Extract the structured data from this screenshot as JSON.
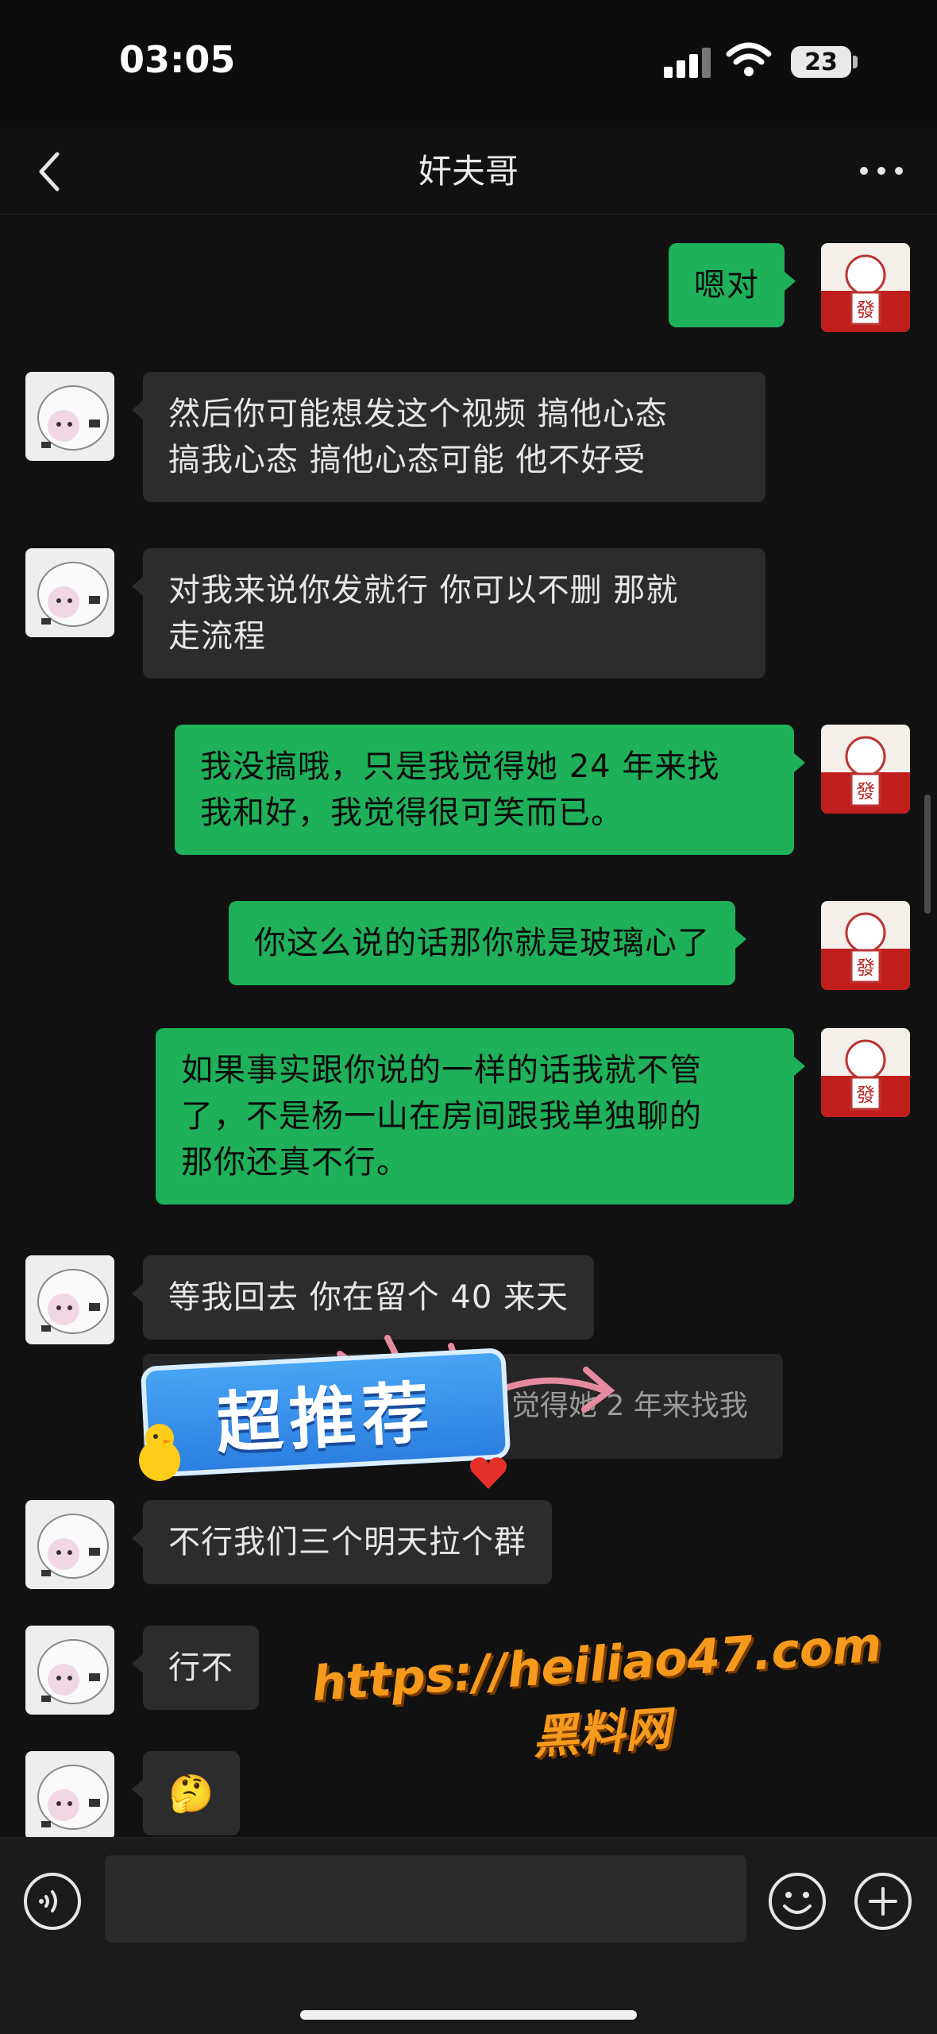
{
  "status_bar": {
    "time": "03:05",
    "battery": "23"
  },
  "header": {
    "title": "奸夫哥",
    "back_icon": "chevron-left-icon",
    "more_icon": "more-dots-icon"
  },
  "messages": [
    {
      "side": "right",
      "avatar": "fa-avatar",
      "text": "嗯对"
    },
    {
      "side": "left",
      "avatar": "cow-avatar",
      "text": "然后你可能想发这个视频 搞他心态\n搞我心态 搞他心态可能 他不好受"
    },
    {
      "side": "left",
      "avatar": "cow-avatar",
      "text": "对我来说你发就行 你可以不删 那就\n走流程"
    },
    {
      "side": "right",
      "avatar": "fa-avatar",
      "text": "我没搞哦，只是我觉得她 24 年来找\n我和好，我觉得很可笑而已。"
    },
    {
      "side": "right",
      "avatar": "fa-avatar",
      "text": "你这么说的话那你就是玻璃心了"
    },
    {
      "side": "right",
      "avatar": "fa-avatar",
      "text": "如果事实跟你说的一样的话我就不管\n了，不是杨一山在房间跟我单独聊的\n那你还真不行。"
    },
    {
      "side": "left",
      "avatar": "cow-avatar",
      "text": "等我回去 你在留个 40 来天"
    },
    {
      "side": "left",
      "avatar": "cow-avatar",
      "text": "不行我们三个明天拉个群"
    },
    {
      "side": "left",
      "avatar": "cow-avatar",
      "text": "行不"
    },
    {
      "side": "left",
      "avatar": "cow-avatar",
      "text": "🤔"
    }
  ],
  "quote": {
    "text": "觉得她 2 年来找我"
  },
  "promo": {
    "sticker_text": "超推荐"
  },
  "watermark": {
    "url": "https://heiliao47.com",
    "name": "黑料网"
  },
  "input_bar": {
    "voice_icon": "voice-icon",
    "placeholder": "",
    "emoji_icon": "smiley-icon",
    "plus_icon": "plus-icon"
  },
  "colors": {
    "sent_bubble": "#1fb05a",
    "received_bubble": "#2c2c2c",
    "background": "#111111",
    "watermark": "#f59a1d"
  }
}
